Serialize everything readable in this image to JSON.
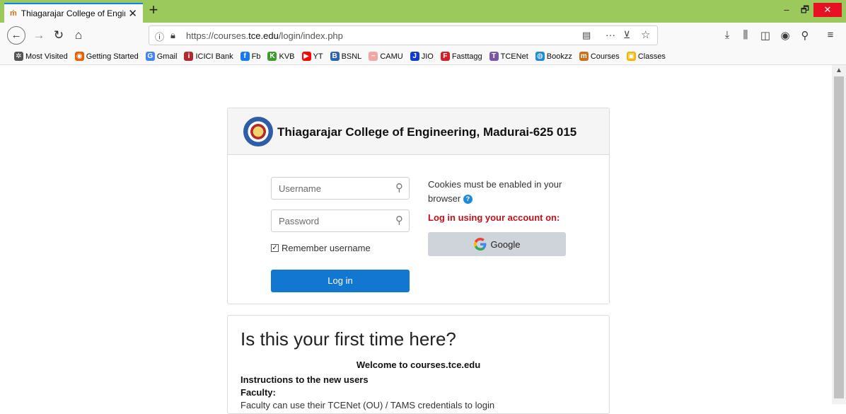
{
  "tab": {
    "title": "Thiagarajar College of Enginee",
    "favicon": "tcn-icon"
  },
  "window": {
    "minimize": "–",
    "maximize": "🗗",
    "close": "✕"
  },
  "nav": {
    "url_prefix": "https://courses.",
    "url_host": "tce.edu",
    "url_path": "/login/index.php",
    "page_actions": "···"
  },
  "bookmarks": [
    {
      "label": "Most Visited",
      "icon": "gear-icon",
      "color": "#555555",
      "glyph": "✲"
    },
    {
      "label": "Getting Started",
      "icon": "firefox-icon",
      "color": "#e66000",
      "glyph": "◉"
    },
    {
      "label": "Gmail",
      "icon": "google-icon",
      "color": "#4285f4",
      "glyph": "G"
    },
    {
      "label": "ICICI Bank",
      "icon": "icici-icon",
      "color": "#b02a30",
      "glyph": "i"
    },
    {
      "label": "Fb",
      "icon": "facebook-icon",
      "color": "#1877f2",
      "glyph": "f"
    },
    {
      "label": "KVB",
      "icon": "kvb-icon",
      "color": "#3f9b2f",
      "glyph": "K"
    },
    {
      "label": "YT",
      "icon": "youtube-icon",
      "color": "#ff0000",
      "glyph": "▶"
    },
    {
      "label": "BSNL",
      "icon": "bsnl-icon",
      "color": "#2b64b0",
      "glyph": "B"
    },
    {
      "label": "CAMU",
      "icon": "camu-icon",
      "color": "#f3a6a6",
      "glyph": "~"
    },
    {
      "label": "JIO",
      "icon": "jio-icon",
      "color": "#0f3cc9",
      "glyph": "J"
    },
    {
      "label": "Fasttagg",
      "icon": "fasttag-icon",
      "color": "#d0202a",
      "glyph": "F"
    },
    {
      "label": "TCENet",
      "icon": "tcenet-icon",
      "color": "#7a55a8",
      "glyph": "T"
    },
    {
      "label": "Bookzz",
      "icon": "globe-icon",
      "color": "#1f8ad6",
      "glyph": "◍"
    },
    {
      "label": "Courses",
      "icon": "tcn-icon",
      "color": "#c8701a",
      "glyph": "m"
    },
    {
      "label": "Classes",
      "icon": "classroom-icon",
      "color": "#f4b400",
      "glyph": "▣"
    }
  ],
  "login": {
    "college_name": "Thiagarajar College of Engineering, Madurai-625 015",
    "username_placeholder": "Username",
    "password_placeholder": "Password",
    "remember_label": "Remember username",
    "remember_checked": true,
    "login_button": "Log in",
    "cookies_text": "Cookies must be enabled in your browser",
    "login_using": "Log in using your account on:",
    "google_button": "Google"
  },
  "first_time": {
    "title": "Is this your first time here?",
    "welcome": "Welcome to courses.tce.edu",
    "instructions": "Instructions to the new users",
    "faculty": "Faculty:",
    "faculty_text": "Faculty can use their TCENet (OU) / TAMS credentials to login"
  },
  "colors": {
    "tabstrip": "#9bc95b",
    "primary_button": "#1177d1",
    "login_using_text": "#c0101a"
  }
}
